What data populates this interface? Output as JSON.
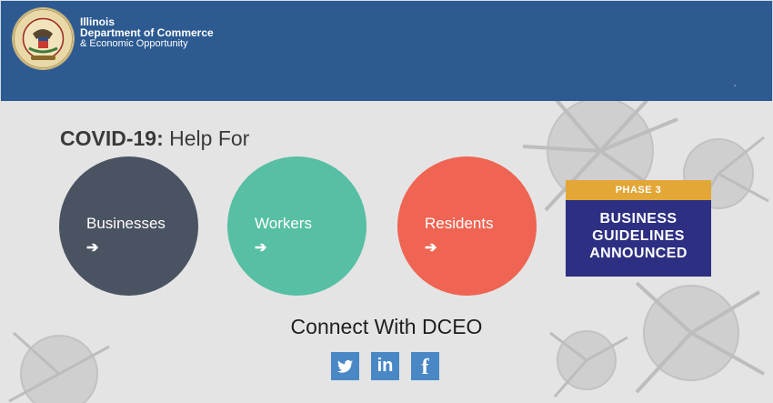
{
  "header": {
    "org_line1": "Illinois",
    "org_line2": "Department of Commerce",
    "org_line3": "& Economic Opportunity",
    "caret": "‸",
    "background_color": "#2c5a91"
  },
  "hero": {
    "heading_bold": "COVID-19:",
    "heading_rest": " Help For",
    "circles": [
      {
        "label": "Businesses",
        "arrow": "➔",
        "color": "#4a5362"
      },
      {
        "label": "Workers",
        "arrow": "➔",
        "color": "#57bfa3"
      },
      {
        "label": "Residents",
        "arrow": "➔",
        "color": "#ef6452"
      }
    ]
  },
  "phase_card": {
    "tag": "PHASE 3",
    "line1": "BUSINESS",
    "line2": "GUIDELINES",
    "line3": "ANNOUNCED",
    "tag_color": "#e2a736",
    "body_color": "#2d2f82"
  },
  "connect": {
    "title": "Connect With DCEO",
    "icons": [
      {
        "name": "twitter-icon",
        "glyph": ""
      },
      {
        "name": "linkedin-icon",
        "glyph": "in"
      },
      {
        "name": "facebook-icon",
        "glyph": "f"
      }
    ],
    "icon_color": "#4a88c5"
  }
}
